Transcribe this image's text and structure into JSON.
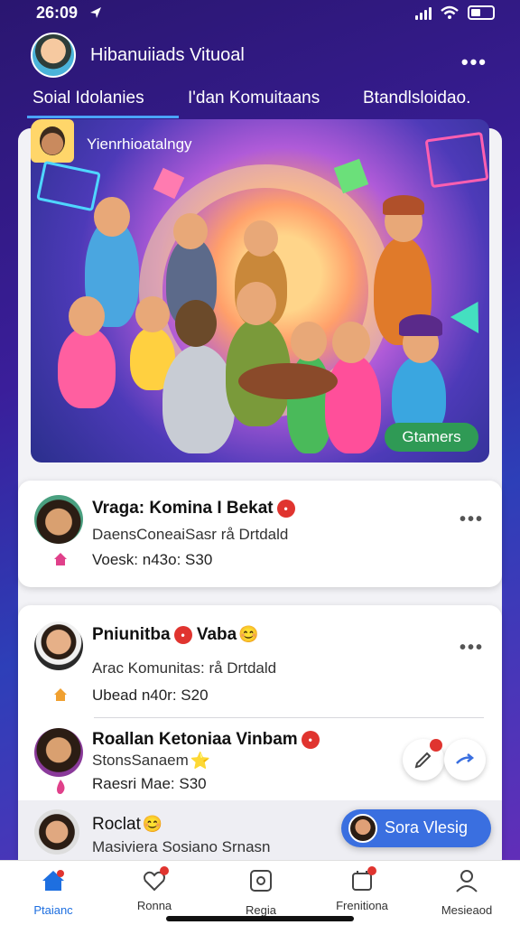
{
  "status_bar": {
    "time": "26:09"
  },
  "header": {
    "title": "Hibanuiiads Vituoal",
    "more": "•••"
  },
  "tabs": [
    {
      "label": "Soial Idolanies",
      "active": true
    },
    {
      "label": "I'dan Komuitaans",
      "active": false
    },
    {
      "label": "Btandlsloidao.",
      "active": false
    }
  ],
  "hero": {
    "title": "Yienrhioatalngy",
    "button_label": "Gtamers"
  },
  "rows": [
    {
      "name": "Vraga: Komina I Bekat",
      "badge": "•",
      "sub": "DaensConeaiSasr rå Drtdald",
      "meta": "Voesk: n43o: S30",
      "icon": "home-icon"
    },
    {
      "name": "Pniunitba",
      "name2": "Vaba",
      "sub": "Arac Komunitas: rå Drtdald",
      "meta": "Ubead n40r: S20",
      "icon": "home-icon"
    },
    {
      "name": "Roallan Ketoniaa Vinbam",
      "sub": "StonsSanaem",
      "meta": "Raesri Mae: S30",
      "icon": "flame-icon"
    },
    {
      "name": "Roclat",
      "sub": "Masiviera Sosiano Srnasn"
    }
  ],
  "video_button": {
    "label": "Sora Vlesig"
  },
  "nav": [
    {
      "label": "Ptaianc",
      "icon": "home-icon",
      "active": true
    },
    {
      "label": "Ronna",
      "icon": "heart-icon",
      "active": false
    },
    {
      "label": "Regia",
      "icon": "share-icon",
      "active": false
    },
    {
      "label": "Frenitiona",
      "icon": "notification-icon",
      "active": false
    },
    {
      "label": "Mesieaod",
      "icon": "profile-icon",
      "active": false
    }
  ],
  "colors": {
    "accent": "#1e6fe0",
    "green_button": "#2f9a55",
    "badge_red": "#e0342f"
  }
}
